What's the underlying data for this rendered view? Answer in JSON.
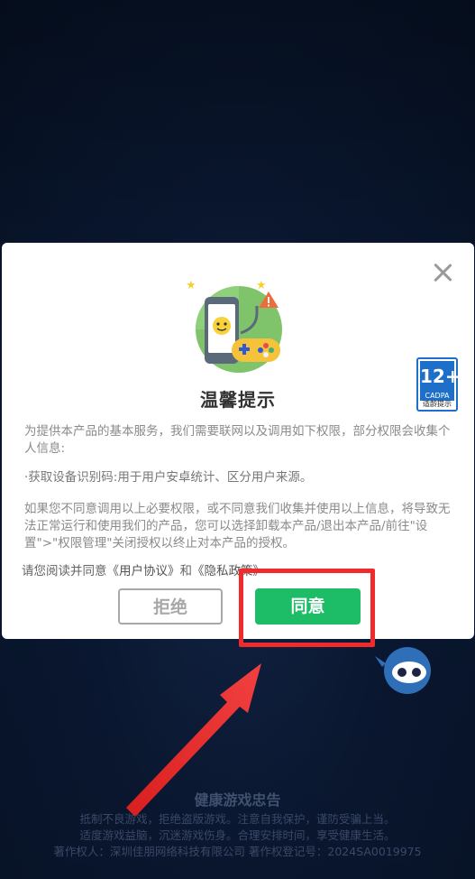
{
  "dialog": {
    "title": "温馨提示",
    "paragraph1": "为提供本产品的基本服务，我们需要联网以及调用如下权限，部分权限会收集个人信息:",
    "paragraph2": "·获取设备识别码:用于用户安卓统计、区分用户来源。",
    "paragraph3": "如果您不同意调用以上必要权限，或不同意我们收集并使用以上信息，将导致无法正常运行和使用我们的产品，您可以选择卸载本产品/退出本产品/前往\"设置\">\"权限管理\"关闭授权以终止对本产品的授权。",
    "consent_prefix": "请您阅读并同意",
    "user_agreement": "《用户协议》",
    "consent_and": "和",
    "privacy_policy": "《隐私政策》",
    "reject_label": "拒绝",
    "agree_label": "同意",
    "age_badge": {
      "rating": "12+",
      "org": "CADPA",
      "caption": "适龄提示"
    }
  },
  "advisory": {
    "heading": "健康游戏忠告",
    "line1": "抵制不良游戏，拒绝盗版游戏。注意自我保护，谨防受骗上当。",
    "line2": "适度游戏益脑，沉迷游戏伤身。合理安排时间，享受健康生活。",
    "line3": "著作权人：深圳佳朋网络科技有限公司  著作权登记号：2024SA0019975"
  },
  "colors": {
    "agree_button": "#1dbd67",
    "highlight_box": "#ef2b2b",
    "badge_blue": "#1d6fc9"
  },
  "icons": [
    "close-icon",
    "phone-gamepad-illustration",
    "age-rating-badge",
    "arrow-pointer"
  ]
}
